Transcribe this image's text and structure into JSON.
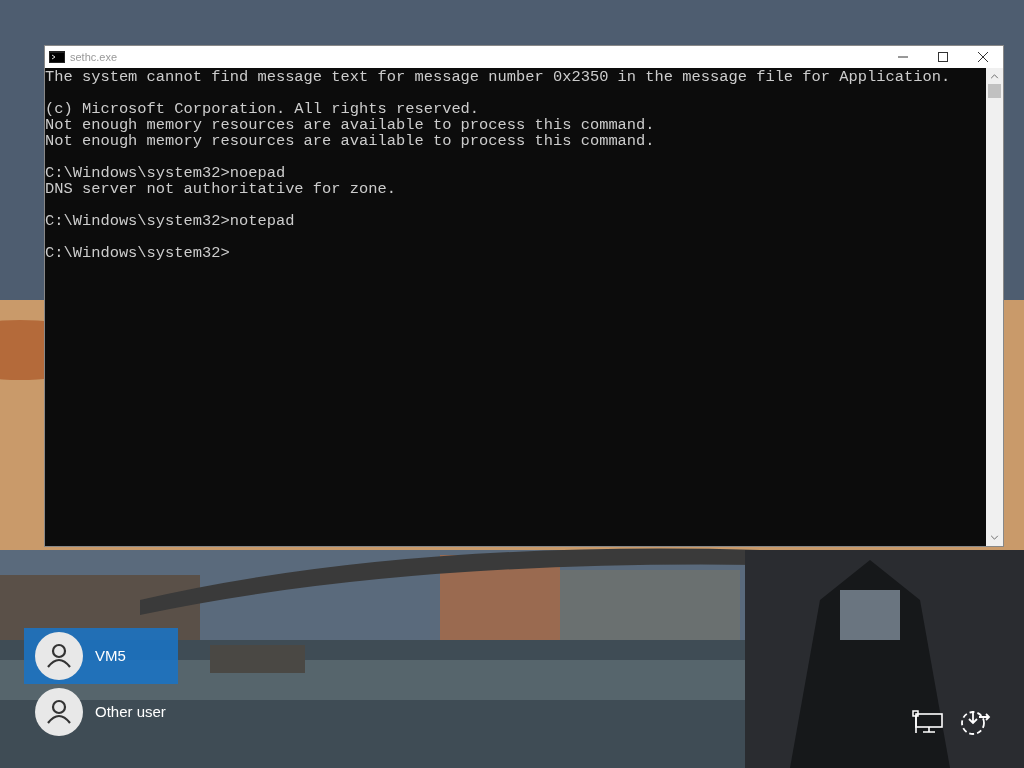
{
  "window": {
    "title": "sethc.exe"
  },
  "console": {
    "blocks": [
      [
        "The system cannot find message text for message number 0x2350 in the message file for Application."
      ],
      [
        "(c) Microsoft Corporation. All rights reserved.",
        "Not enough memory resources are available to process this command.",
        "Not enough memory resources are available to process this command."
      ],
      [
        "C:\\Windows\\system32>noepad",
        "DNS server not authoritative for zone."
      ],
      [
        "C:\\Windows\\system32>notepad"
      ],
      [
        "C:\\Windows\\system32>"
      ]
    ]
  },
  "users": [
    {
      "name": "VM5",
      "selected": true
    },
    {
      "name": "Other user",
      "selected": false
    }
  ]
}
